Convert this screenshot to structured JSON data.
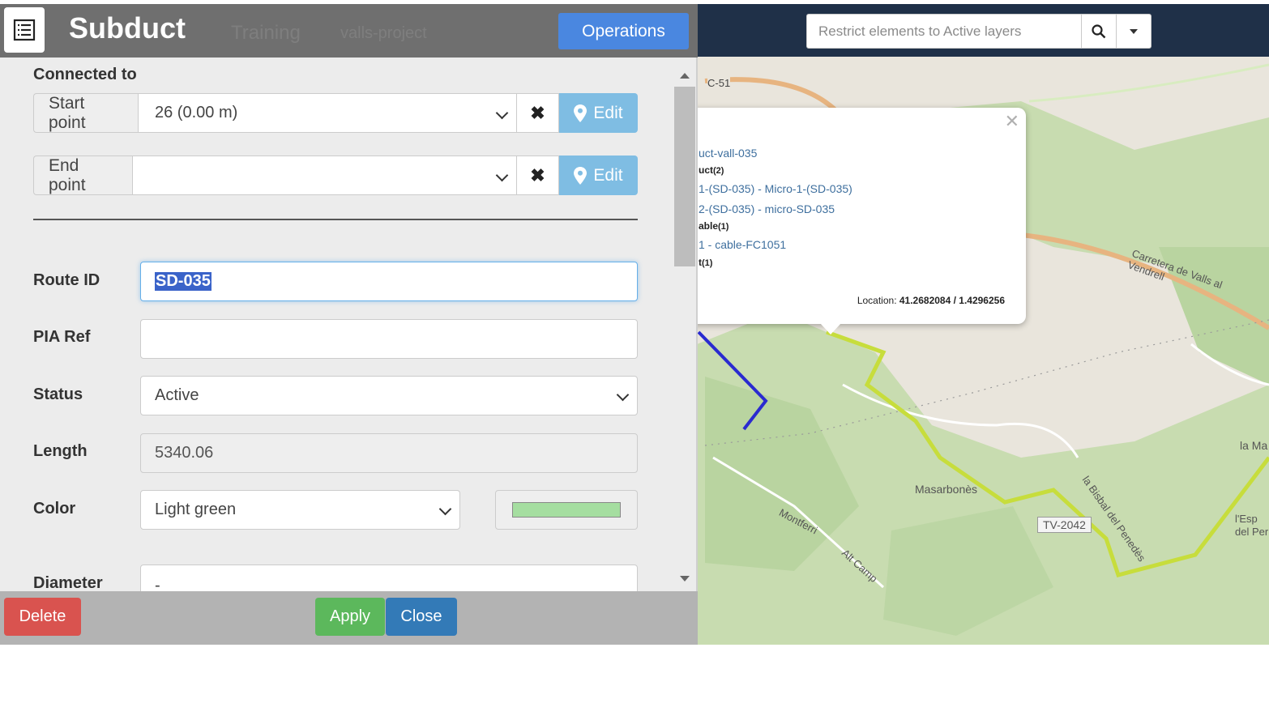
{
  "panel": {
    "title": "Subduct",
    "menu_icon": "list-icon",
    "ghost_tabs": [
      "Training",
      "valls-project"
    ],
    "operations_label": "Operations",
    "connected_to_label": "Connected to",
    "start_point": {
      "label": "Start point",
      "value": "26 (0.00 m)",
      "edit_label": "Edit"
    },
    "end_point": {
      "label": "End point",
      "value": "",
      "edit_label": "Edit"
    },
    "fields": {
      "route_id": {
        "label": "Route ID",
        "value": "SD-035"
      },
      "pia_ref": {
        "label": "PIA Ref",
        "value": ""
      },
      "status": {
        "label": "Status",
        "value": "Active"
      },
      "length": {
        "label": "Length",
        "value": "5340.06"
      },
      "color": {
        "label": "Color",
        "value": "Light green",
        "swatch": "#a5dea0"
      },
      "diameter": {
        "label": "Diameter",
        "value": "-"
      }
    },
    "footer": {
      "delete_label": "Delete",
      "apply_label": "Apply",
      "close_label": "Close"
    }
  },
  "search": {
    "placeholder": "Restrict elements to Active layers",
    "icon": "search-icon"
  },
  "popup": {
    "duct_link": "uct-vall-035",
    "microduct_header": "uct",
    "microduct_count": "(2)",
    "microduct_links": [
      "1-(SD-035) - Micro-1-(SD-035)",
      "2-(SD-035) - micro-SD-035"
    ],
    "fibre_header": "able",
    "fibre_count": "(1)",
    "fibre_link": "1 - cable-FC1051",
    "subduct_header": "t",
    "subduct_count": "(1)",
    "location_label": "Location:",
    "location_value": "41.2682084 / 1.4296256"
  },
  "map_labels": {
    "road_c51": "C-51",
    "carretera": "Carretera de Valls al Vendrell",
    "masarbones": "Masarbonès",
    "tv2042": "TV-2042",
    "la_bisbal": "la Bisbal del Penedès",
    "montferri": "Montferri",
    "alt_camp": "Alt Camp",
    "la_ma": "la Ma",
    "esp": "l'Esp del Per"
  },
  "colors": {
    "header": "#6f6f6f",
    "operations": "#4a87e0",
    "edit": "#7fbde3",
    "delete": "#d9534f",
    "apply": "#5cb85c",
    "close": "#337ab7",
    "route_line": "#c7dd3c",
    "blue_line": "#2a2ad0"
  }
}
